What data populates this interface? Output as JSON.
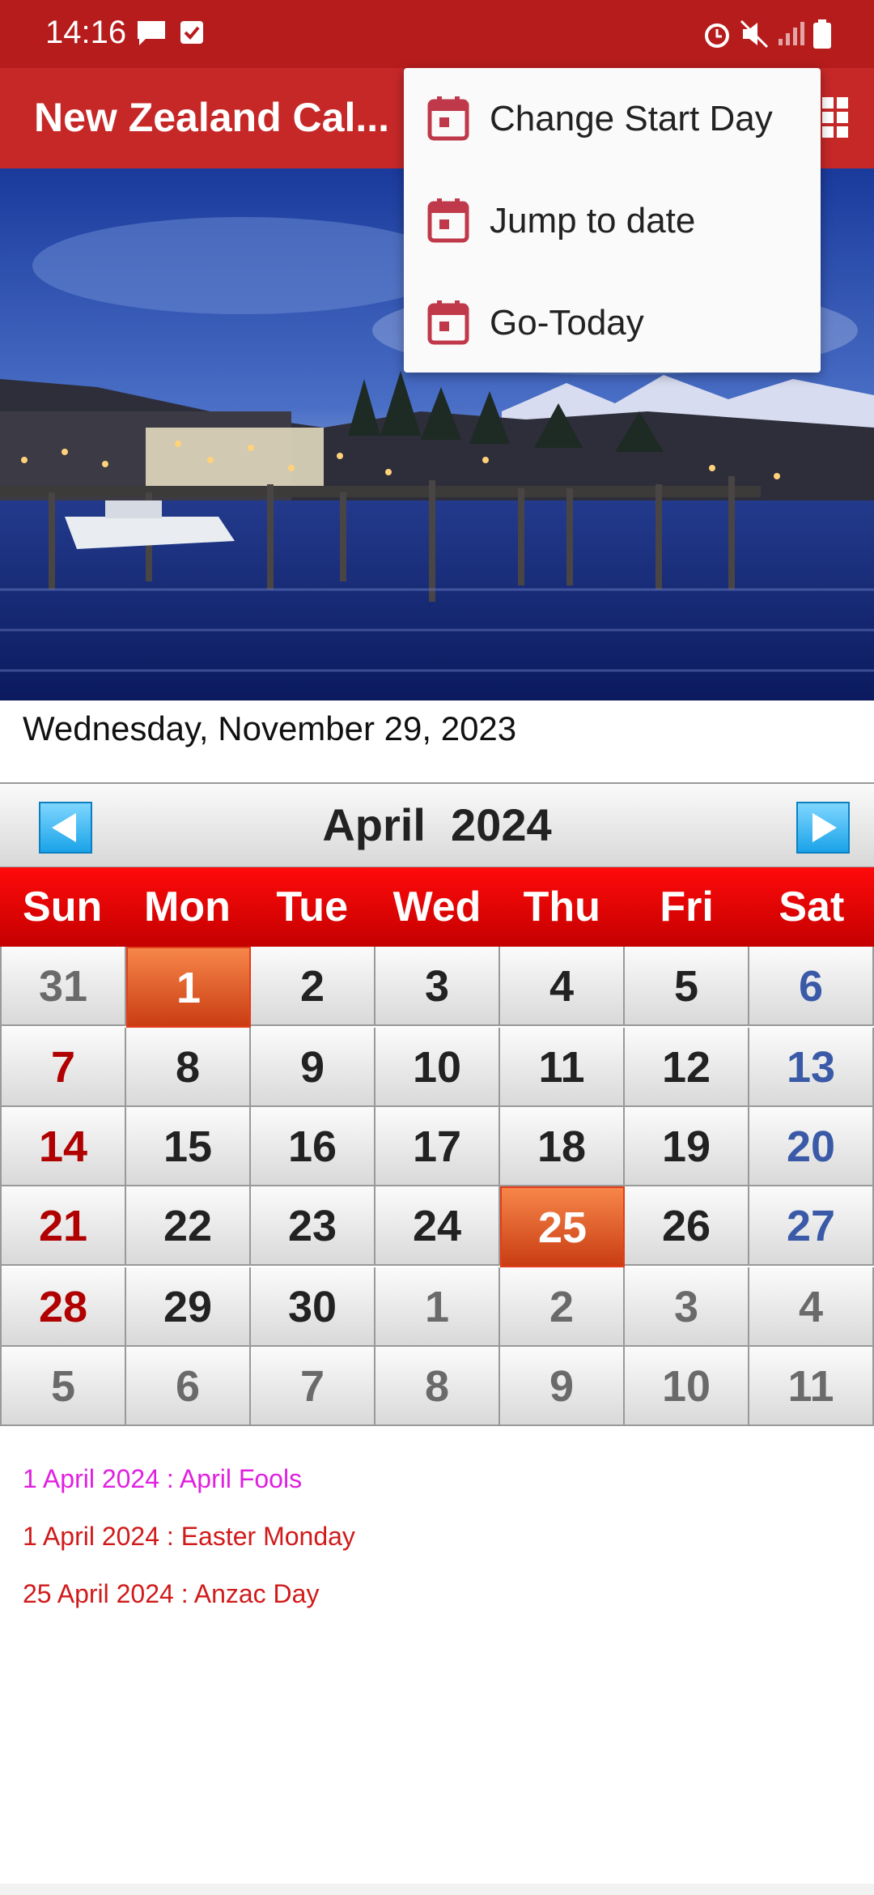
{
  "status_bar": {
    "time": "14:16"
  },
  "app_bar": {
    "title": "New Zealand Cal..."
  },
  "menu": {
    "items": [
      {
        "label": "Change Start Day"
      },
      {
        "label": "Jump to date"
      },
      {
        "label": "Go-Today"
      }
    ]
  },
  "current_date": "Wednesday, November 29, 2023",
  "calendar": {
    "month_title": "April  2024",
    "weekdays": [
      "Sun",
      "Mon",
      "Tue",
      "Wed",
      "Thu",
      "Fri",
      "Sat"
    ],
    "days": [
      "31",
      "1",
      "2",
      "3",
      "4",
      "5",
      "6",
      "7",
      "8",
      "9",
      "10",
      "11",
      "12",
      "13",
      "14",
      "15",
      "16",
      "17",
      "18",
      "19",
      "20",
      "21",
      "22",
      "23",
      "24",
      "25",
      "26",
      "27",
      "28",
      "29",
      "30",
      "1",
      "2",
      "3",
      "4",
      "5",
      "6",
      "7",
      "8",
      "9",
      "10",
      "11"
    ]
  },
  "events": [
    {
      "text": "1 April 2024 : April Fools",
      "color": "#e020e0"
    },
    {
      "text": "1 April 2024 : Easter Monday",
      "color": "#d11a1a"
    },
    {
      "text": "25 April 2024 : Anzac Day",
      "color": "#d11a1a"
    }
  ],
  "colors": {
    "status_bar": "#b71c1c",
    "app_bar": "#c62828",
    "weekday_row": "#e00000",
    "highlight": "#e85a2a"
  }
}
